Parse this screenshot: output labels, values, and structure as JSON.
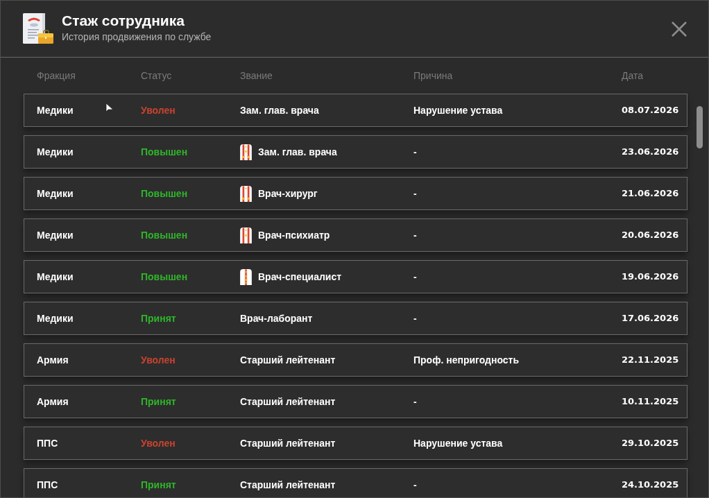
{
  "window": {
    "title": "Стаж сотрудника",
    "subtitle": "История продвижения по службе"
  },
  "table": {
    "columns": [
      "Фракция",
      "Статус",
      "Звание",
      "Причина",
      "Дата"
    ],
    "rows": [
      {
        "faction": "Медики",
        "status": {
          "label": "Уволен",
          "color": "#c9432f"
        },
        "rank": {
          "label": "Зам. глав. врача",
          "kind": "plain"
        },
        "reason": "Нарушение устава",
        "date": "08.07.2026"
      },
      {
        "faction": "Медики",
        "status": {
          "label": "Повышен",
          "color": "#2fb52a"
        },
        "rank": {
          "label": "Зам. глав. врача",
          "kind": "two-stripes-4"
        },
        "reason": "-",
        "date": "23.06.2026"
      },
      {
        "faction": "Медики",
        "status": {
          "label": "Повышен",
          "color": "#2fb52a"
        },
        "rank": {
          "label": "Врач-хирург",
          "kind": "two-stripes-3"
        },
        "reason": "-",
        "date": "21.06.2026"
      },
      {
        "faction": "Медики",
        "status": {
          "label": "Повышен",
          "color": "#2fb52a"
        },
        "rank": {
          "label": "Врач-психиатр",
          "kind": "two-stripes-2"
        },
        "reason": "-",
        "date": "20.06.2026"
      },
      {
        "faction": "Медики",
        "status": {
          "label": "Повышен",
          "color": "#2fb52a"
        },
        "rank": {
          "label": "Врач-специалист",
          "kind": "one-stripe-3"
        },
        "reason": "-",
        "date": "19.06.2026"
      },
      {
        "faction": "Медики",
        "status": {
          "label": "Принят",
          "color": "#2fb52a"
        },
        "rank": {
          "label": "Врач-лаборант",
          "kind": "plain"
        },
        "reason": "-",
        "date": "17.06.2026"
      },
      {
        "faction": "Армия",
        "status": {
          "label": "Уволен",
          "color": "#c9432f"
        },
        "rank": {
          "label": "Старший лейтенант",
          "kind": "plain"
        },
        "reason": "Проф. непригодность",
        "date": "22.11.2025"
      },
      {
        "faction": "Армия",
        "status": {
          "label": "Принят",
          "color": "#2fb52a"
        },
        "rank": {
          "label": "Старший лейтенант",
          "kind": "plain"
        },
        "reason": "-",
        "date": "10.11.2025"
      },
      {
        "faction": "ППС",
        "status": {
          "label": "Уволен",
          "color": "#c9432f"
        },
        "rank": {
          "label": "Старший лейтенант",
          "kind": "plain"
        },
        "reason": "Нарушение устава",
        "date": "29.10.2025"
      },
      {
        "faction": "ППС",
        "status": {
          "label": "Принят",
          "color": "#2fb52a"
        },
        "rank": {
          "label": "Старший лейтенант",
          "kind": "plain"
        },
        "reason": "-",
        "date": "24.10.2025"
      }
    ]
  }
}
